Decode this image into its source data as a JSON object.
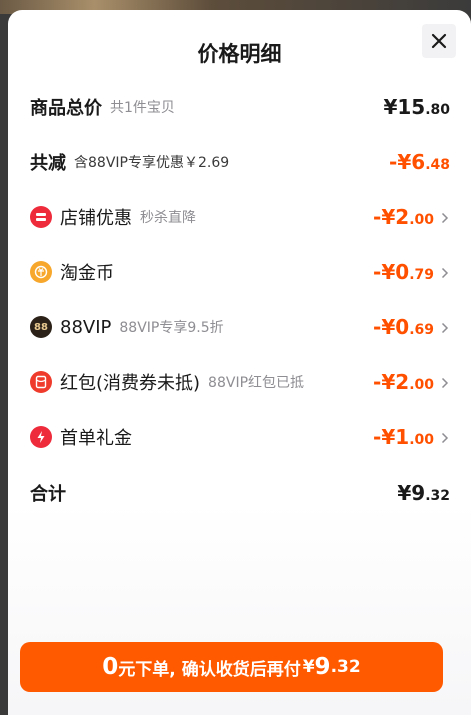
{
  "header": {
    "title": "价格明细"
  },
  "rows": {
    "total": {
      "label": "商品总价",
      "sub": "共1件宝贝",
      "amount_int": "¥15",
      "amount_dec": ".80"
    },
    "discount": {
      "label": "共减",
      "sub": "含88VIP专享优惠￥2.69",
      "amount_int": "-¥6",
      "amount_dec": ".48"
    },
    "shop": {
      "label": "店铺优惠",
      "sub": "秒杀直降",
      "amount_int": "-¥2",
      "amount_dec": ".00"
    },
    "coin": {
      "label": "淘金币",
      "amount_int": "-¥0",
      "amount_dec": ".79"
    },
    "vip": {
      "label": "88VIP",
      "sub": "88VIP专享9.5折",
      "amount_int": "-¥0",
      "amount_dec": ".69",
      "badge": "88"
    },
    "redpacket": {
      "label": "红包(消费券未抵)",
      "sub": "88VIP红包已抵",
      "amount_int": "-¥2",
      "amount_dec": ".00"
    },
    "firstorder": {
      "label": "首单礼金",
      "amount_int": "-¥1",
      "amount_dec": ".00"
    },
    "sum": {
      "label": "合计",
      "amount_int": "¥9",
      "amount_dec": ".32"
    }
  },
  "footer": {
    "zero": "0",
    "text": "元下单, 确认收货后再付",
    "currency": "¥",
    "pay_int": "9",
    "pay_dec": ".32"
  },
  "colors": {
    "accent": "#ff5000",
    "button": "#ff5a00",
    "shop_icon": "#ee2b3b",
    "coin_icon": "#f7a72b",
    "vip_icon": "#2b2118",
    "red_icon": "#ee3b2b",
    "gift_icon": "#ee2b3b"
  },
  "icons": [
    "close-icon",
    "shop-discount-icon",
    "taojinbi-coin-icon",
    "88vip-badge-icon",
    "red-packet-icon",
    "lightning-gift-icon",
    "chevron-right-icon"
  ]
}
